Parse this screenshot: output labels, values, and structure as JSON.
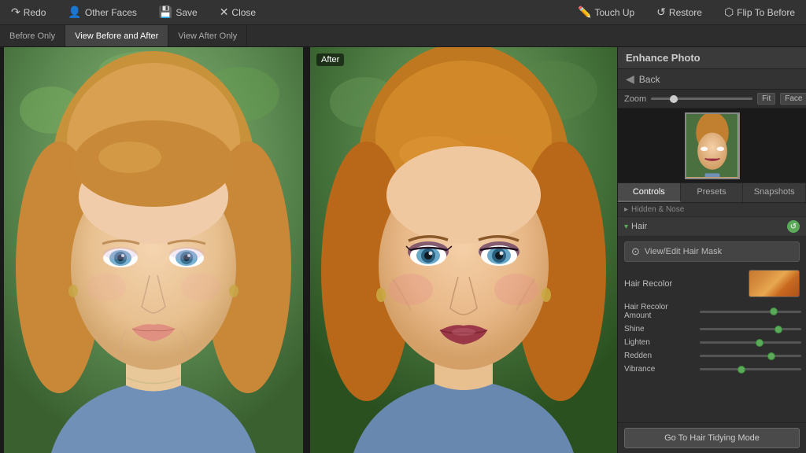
{
  "toolbar": {
    "redo_label": "Redo",
    "other_faces_label": "Other Faces",
    "save_label": "Save",
    "close_label": "Close",
    "touch_up_label": "Touch Up",
    "restore_label": "Restore",
    "flip_to_before_label": "Flip To Before"
  },
  "view_tabs": {
    "before_only": "Before Only",
    "before_and_after": "View Before and After",
    "after_only": "View After Only"
  },
  "photo_labels": {
    "after": "After"
  },
  "panel": {
    "title": "Enhance Photo",
    "back_label": "Back",
    "zoom_label": "Zoom",
    "zoom_fit": "Fit",
    "zoom_face": "Face",
    "tabs": {
      "controls": "Controls",
      "presets": "Presets",
      "snapshots": "Snapshots"
    },
    "hidden_section": "Hidden & Nose",
    "hair_section": "Hair",
    "mask_btn": "View/Edit Hair Mask",
    "hair_recolor_label": "Hair Recolor",
    "sliders": [
      {
        "label": "Hair Recolor Amount",
        "value": 75
      },
      {
        "label": "Shine",
        "value": 80
      },
      {
        "label": "Lighten",
        "value": 60
      },
      {
        "label": "Redden",
        "value": 72
      },
      {
        "label": "Vibrance",
        "value": 40
      }
    ],
    "hair_tidy_btn": "Go To Hair Tidying Mode"
  }
}
